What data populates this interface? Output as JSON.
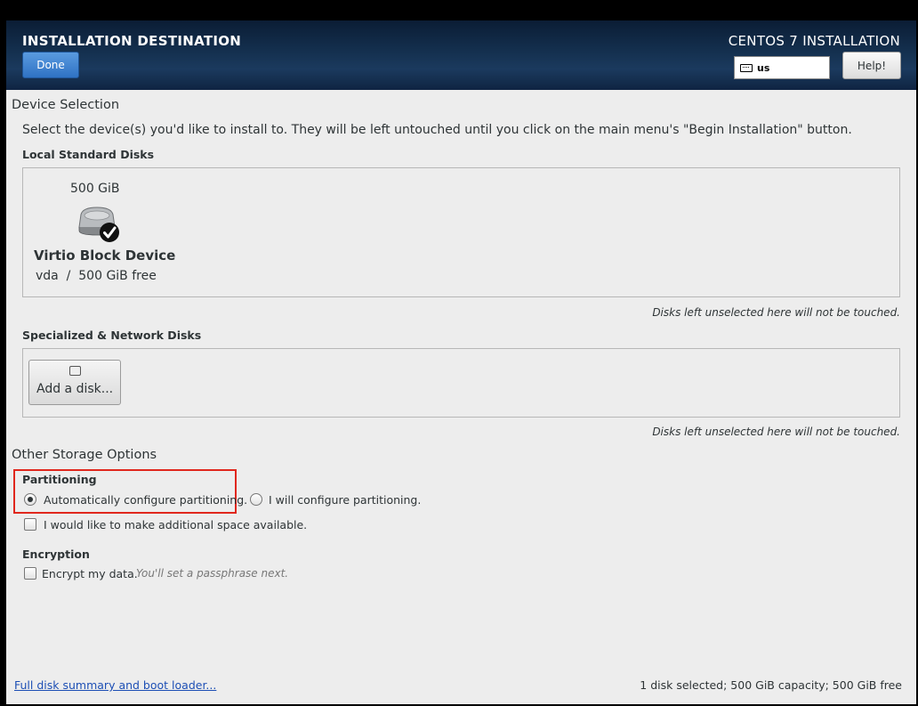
{
  "header": {
    "title": "INSTALLATION DESTINATION",
    "done_label": "Done",
    "product": "CENTOS 7 INSTALLATION",
    "keyboard_layout": "us",
    "help_label": "Help!"
  },
  "device_selection": {
    "heading": "Device Selection",
    "intro": "Select the device(s) you'd like to install to.  They will be left untouched until you click on the main menu's \"Begin Installation\" button.",
    "local_label": "Local Standard Disks",
    "disk": {
      "size": "500 GiB",
      "name": "Virtio Block Device",
      "details": "vda  /  500 GiB free",
      "selected": true
    },
    "untouched_note_local": "Disks left unselected here will not be touched.",
    "network_label": "Specialized & Network Disks",
    "add_disk_label": "Add a disk...",
    "untouched_note_network": "Disks left unselected here will not be touched."
  },
  "other_storage": {
    "heading": "Other Storage Options",
    "partitioning_label": "Partitioning",
    "auto_label": "Automatically configure partitioning.",
    "manual_label": "I will configure partitioning.",
    "selected": "auto",
    "extra_space_label": "I would like to make additional space available.",
    "encryption_label": "Encryption",
    "encrypt_label": "Encrypt my data.",
    "encrypt_hint": "You'll set a passphrase next."
  },
  "footer": {
    "summary_link": "Full disk summary and boot loader...",
    "status": "1 disk selected; 500 GiB capacity; 500 GiB free"
  },
  "colors": {
    "highlight": "#e0271d",
    "done_button": "#2f72c4",
    "link": "#1d4fb5"
  },
  "icons": [
    "keyboard-icon",
    "hard-disk-icon",
    "checkmark-icon",
    "add-disk-icon"
  ]
}
